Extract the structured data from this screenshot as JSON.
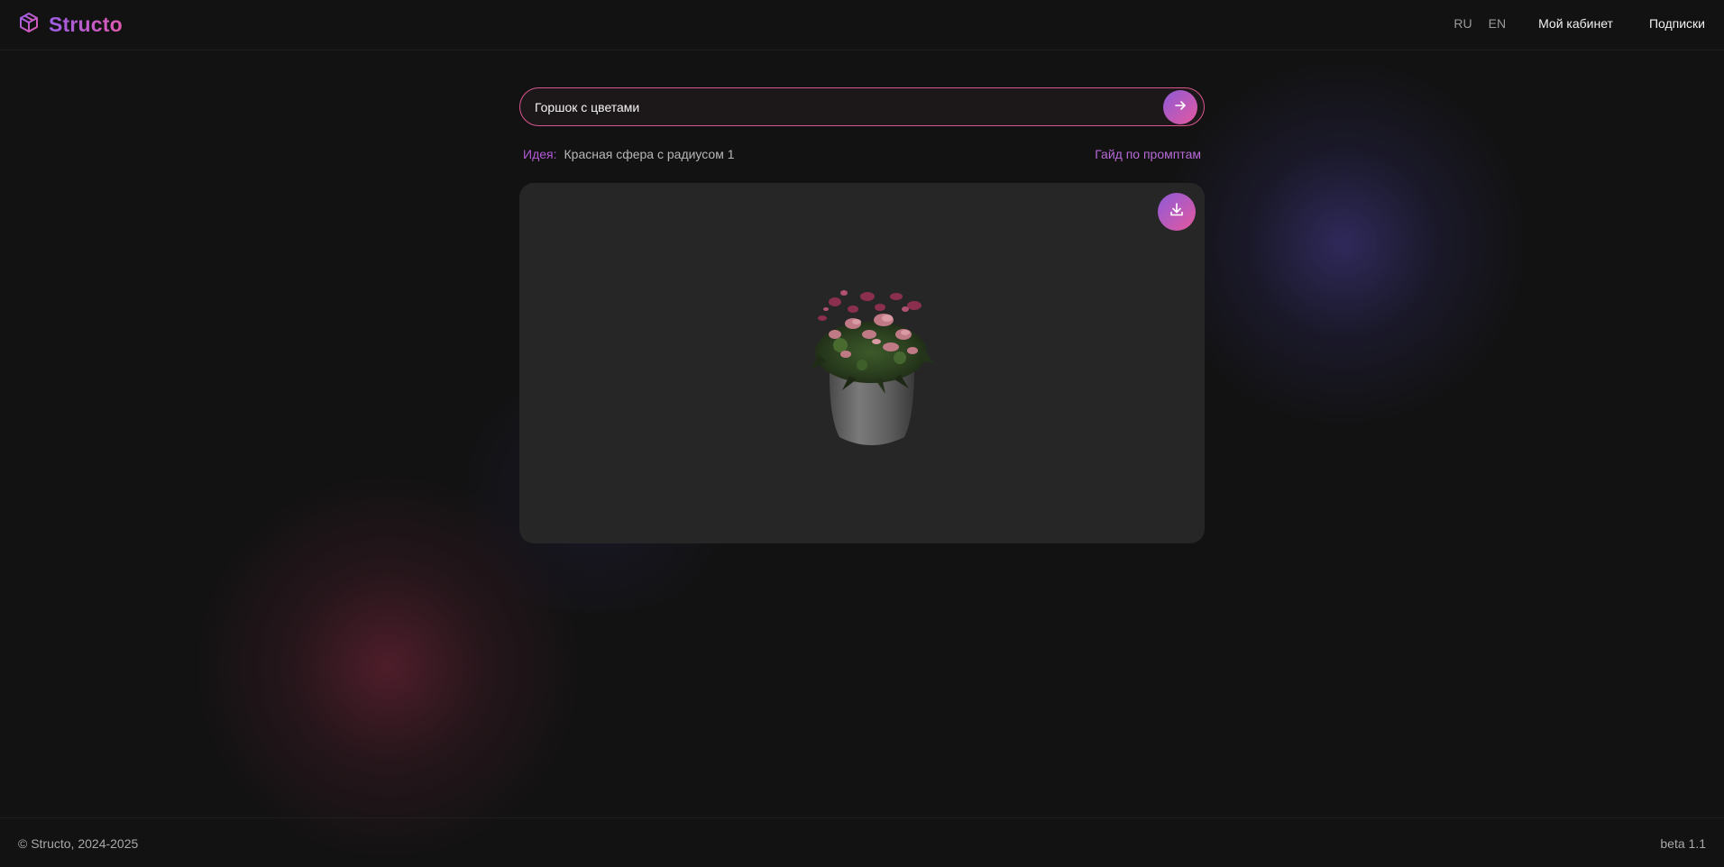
{
  "app": {
    "brand": "Structo",
    "brand_gradient": [
      "#9b5de5",
      "#e05ab0"
    ]
  },
  "nav": {
    "lang_ru": "RU",
    "lang_en": "EN",
    "cabinet": "Мой кабинет",
    "subscriptions": "Подписки"
  },
  "search": {
    "value": "Горшок с цветами",
    "send_icon": "arrow-right-icon"
  },
  "idea": {
    "label": "Идея:",
    "text": "Красная сфера с радиусом 1",
    "guide": "Гайд по промптам"
  },
  "viewer": {
    "download_icon": "download-icon",
    "model": "flower-pot-3d-model"
  },
  "footer": {
    "copyright": "© Structo, 2024-2025",
    "version": "beta 1.1"
  },
  "colors": {
    "background": "#121212",
    "accent_pink": "#e05ab0",
    "accent_purple": "#9b5de5",
    "viewer_bg": "#262626"
  }
}
